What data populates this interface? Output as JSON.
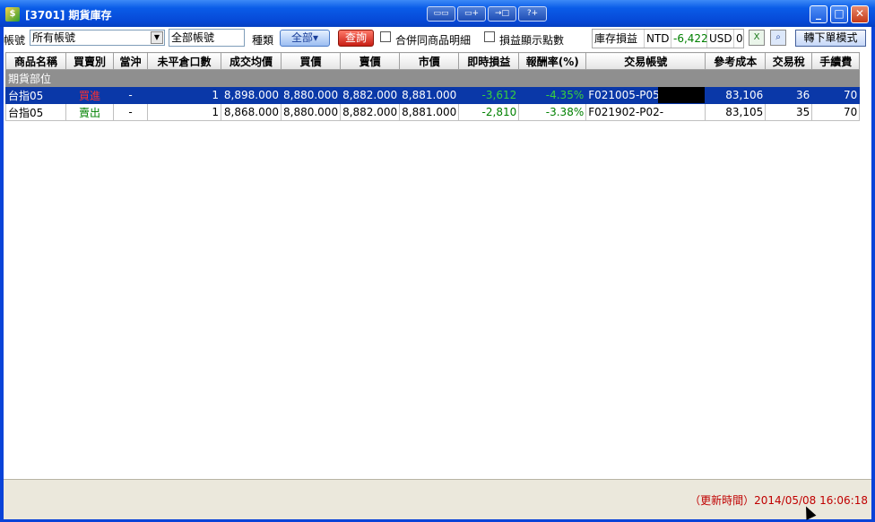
{
  "window": {
    "title": "[3701] 期貨庫存",
    "toolbar_buttons": [
      "layout-icon",
      "window-icon",
      "export-icon",
      "help-icon"
    ],
    "controls": {
      "minimize_label": "_",
      "maximize_label": "□",
      "close_label": "✕"
    }
  },
  "toolbar": {
    "account_label": "帳號",
    "account_value": "所有帳號",
    "account_name": "全部帳號",
    "type_label": "種類",
    "type_button": "全部",
    "query_button": "查詢",
    "merge_label": "合併同商品明細",
    "points_label": "損益顯示點數",
    "inventory_label": "庫存損益",
    "ntd_label": "NTD",
    "ntd_value": "-6,422",
    "usd_label": "USD",
    "usd_value": "0",
    "order_button": "轉下單模式"
  },
  "colors": {
    "title_bar": "#0a5ce8",
    "selected_row": "#0a38a8",
    "profit_negative": "#008000",
    "buy": "#d00000",
    "sell": "#008000",
    "update_time": "#c00000"
  },
  "table": {
    "columns": [
      "商品名稱",
      "買賣別",
      "當沖",
      "未平倉口數",
      "成交均價",
      "買價",
      "賣價",
      "市價",
      "即時損益",
      "報酬率(%)",
      "交易帳號",
      "參考成本",
      "交易稅",
      "手續費"
    ],
    "group_label": "期貨部位",
    "rows": [
      {
        "product": "台指05",
        "side": "買進",
        "daytrade": "-",
        "open_qty": "1",
        "avg_price": "8,898.000",
        "bid": "8,880.000",
        "ask": "8,882.000",
        "market": "8,881.000",
        "pnl": "-3,612",
        "return": "-4.35%",
        "account": "F021005-P05-",
        "cost": "83,106",
        "tax": "36",
        "fee": "70",
        "selected": true
      },
      {
        "product": "台指05",
        "side": "賣出",
        "daytrade": "-",
        "open_qty": "1",
        "avg_price": "8,868.000",
        "bid": "8,880.000",
        "ask": "8,882.000",
        "market": "8,881.000",
        "pnl": "-2,810",
        "return": "-3.38%",
        "account": "F021902-P02-",
        "cost": "83,105",
        "tax": "35",
        "fee": "70",
        "selected": false
      }
    ]
  },
  "status": {
    "update_time": "（更新時間）2014/05/08 16:06:18"
  }
}
